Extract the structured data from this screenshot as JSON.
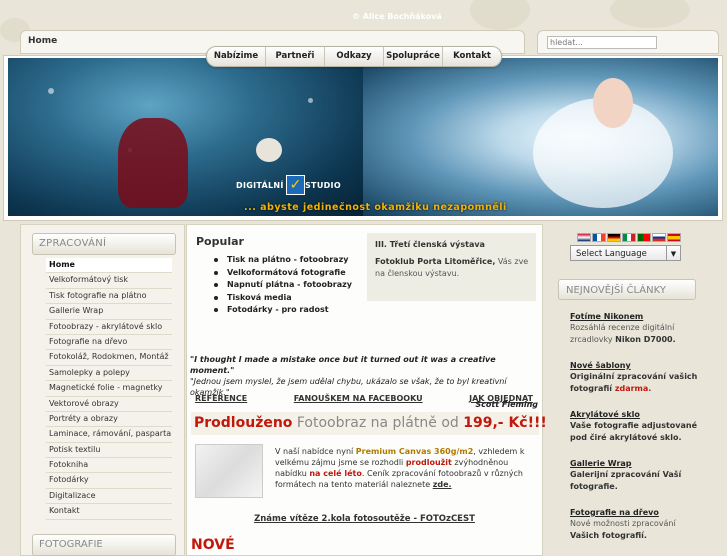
{
  "breadcrumb": "Home",
  "search": {
    "placeholder": "hledat..."
  },
  "topnav": [
    "Nabízime",
    "Partneři",
    "Odkazy",
    "Spolupráce",
    "Kontakt"
  ],
  "banner": {
    "copyright": "© Alice Bochňáková",
    "logo_left": "DIGITÁLNÍ",
    "logo_right": "STUDIO",
    "slogan": "... abyste jedinečnost okamžiku nezapomněli"
  },
  "sidebar": {
    "heading": "ZPRACOVÁNÍ",
    "items": [
      "Home",
      "Velkoformátový tisk",
      "Tisk fotografie na plátno",
      "Gallerie Wrap",
      "Fotoobrazy - akrylátové sklo",
      "Fotografie na dřevo",
      "Fotokoláž, Rodokmen, Montáž",
      "Samolepky a polepy",
      "Magnetické folie - magnetky",
      "Vektorové obrazy",
      "Portréty a obrazy",
      "Laminace, rámování, pasparta",
      "Potisk textilu",
      "Fotokniha",
      "Fotodárky",
      "Digitalizace",
      "Kontakt"
    ],
    "heading2": "FOTOGRAFIE"
  },
  "popular": {
    "title": "Popular",
    "items": [
      "Tisk na plátno - fotoobrazy",
      "Velkoformátová fotografie",
      "Napnutí plátna - fotoobrazy",
      "Tisková media",
      "Fotodárky - pro radost"
    ]
  },
  "exhibit": {
    "title": "III. Třetí členská výstava",
    "bold": "Fotoklub Porta Litoměřice,",
    "text": " Vás zve na členskou výstavu."
  },
  "quote": {
    "en": "\"I thought I made a mistake once but it turned out it was a creative moment.\"",
    "cz": "\"Jednou jsem myslel, že jsem udělal chybu, ukázalo se však, že to byl kreativní okamžik.\"",
    "author": "Scott Fleming"
  },
  "links": [
    "REFERENCE",
    "FANOUŠKEM NA FACEBOOKU",
    "JAK OBJEDNAT"
  ],
  "promo": {
    "word": "Prodlouženo",
    "text": " Fotoobraz na plátně od ",
    "price": "199,- Kč!!!"
  },
  "canvas": {
    "p1": "V naší nabídce nyní ",
    "hl": "Premium Canvas 360g/m2",
    "p2": ", vzhledem k velkému zájmu jsme se rozhodli ",
    "rd1": "prodloužit",
    "p3": " zvýhodněnou nabídku ",
    "rd2": "na celé léto",
    "p4": ". Ceník zpracování fotoobrazů v různých formátech na tento materiál naleznete ",
    "link": "zde."
  },
  "winners": "Známe vítěze 2.kola fotosoutěže - FOTOzCEST",
  "novew": "NOVÉ",
  "language": {
    "select_label": "Select Language",
    "flags": [
      "#c8102e",
      "#0055a4",
      "#000000",
      "#008c45",
      "#006600",
      "#0039a6",
      "#c60b1e"
    ]
  },
  "articles": {
    "heading": "NEJNOVĚJŠÍ ČLÁNKY",
    "items": [
      {
        "title": "Fotíme Nikonem",
        "text": "Rozsáhlá recenze digitální zrcadlovky ",
        "bold": "Nikon D7000."
      },
      {
        "title": "Nové šablony",
        "bold": "Originální zpracování vašich fotografií ",
        "red": "zdarma."
      },
      {
        "title": "Akrylátové sklo",
        "bold": "Vaše fotografie adjustované pod čiré akrylátové sklo."
      },
      {
        "title": "Gallerie Wrap",
        "bold": "Galerijní zpracování Vaší fotografie."
      },
      {
        "title": "Fotografie na dřevo",
        "text": "Nové možnosti zpracování ",
        "bold": "Vašich fotografií."
      }
    ]
  }
}
